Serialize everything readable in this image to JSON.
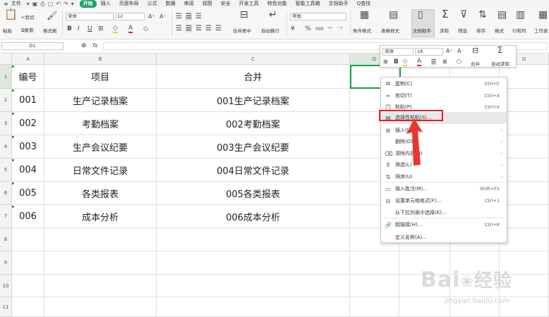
{
  "menubar": {
    "file_label": "文件",
    "items": [
      "开始",
      "插入",
      "页面布局",
      "公式",
      "数据",
      "审阅",
      "视图",
      "安全",
      "开发工具",
      "特色功能",
      "智能工具箱",
      "文档助手"
    ],
    "active_index": 0,
    "search_label": "Q查找"
  },
  "toolbar": {
    "paste": "粘贴",
    "cut": "剪切",
    "copy": "复制",
    "format_painter": "格式刷",
    "font_name": "宋体",
    "font_size": "12",
    "merge_center": "合并居中",
    "wrap_text": "自动换行",
    "number_format": "常规",
    "percent_symbol": "%",
    "thousands": "000",
    "cond_format": "条件格式",
    "table_style": "表格样式",
    "doc_helper": "文档助手",
    "sum": "求和",
    "filter": "筛选",
    "sort": "排序",
    "format": "格式",
    "rows_cols": "行和列",
    "worksheet": "工作表"
  },
  "formula_bar": {
    "name_box": "D1",
    "fx_label": "fx",
    "value": ""
  },
  "grid": {
    "columns": [
      "A",
      "B",
      "C",
      "D",
      "E",
      "F",
      "G"
    ],
    "row_numbers": [
      "1",
      "2",
      "3",
      "4",
      "5",
      "6",
      "7",
      "8",
      "9",
      "10",
      "11"
    ],
    "rows": [
      [
        "编号",
        "项目",
        "合并"
      ],
      [
        "001",
        "生产记录档案",
        "001生产记录档案"
      ],
      [
        "002",
        "考勤档案",
        "002考勤档案"
      ],
      [
        "003",
        "生产会议纪要",
        "003生产会议纪要"
      ],
      [
        "004",
        "日常文件记录",
        "004日常文件记录"
      ],
      [
        "005",
        "各类报表",
        "005各类报表"
      ],
      [
        "006",
        "成本分析",
        "006成本分析"
      ]
    ]
  },
  "mini_toolbar": {
    "font_name": "宋体",
    "font_size": "18",
    "merge": "合并",
    "autosum": "自动求和"
  },
  "context_menu": {
    "items": [
      {
        "label": "复制(C)",
        "shortcut": "Ctrl+C",
        "icon": "copy-icon",
        "glyph": "⧉",
        "arrow": ""
      },
      {
        "label": "剪切(T)",
        "shortcut": "Ctrl+X",
        "icon": "cut-icon",
        "glyph": "✂",
        "arrow": ""
      },
      {
        "label": "粘贴(P)",
        "shortcut": "Ctrl+V",
        "icon": "paste-icon",
        "glyph": "📋",
        "arrow": ""
      },
      {
        "label": "选择性粘贴(S)...",
        "shortcut": "",
        "icon": "paste-special-icon",
        "glyph": "▤",
        "arrow": ""
      },
      {
        "label": "插入(I)",
        "shortcut": "",
        "icon": "insert-icon",
        "glyph": "⊞",
        "arrow": "›"
      },
      {
        "label": "删除(D)",
        "shortcut": "",
        "icon": "",
        "glyph": "",
        "arrow": "›"
      },
      {
        "label": "清除内容(N)",
        "shortcut": "",
        "icon": "clear-icon",
        "glyph": "⌫",
        "arrow": "›"
      },
      {
        "label": "筛选(L)",
        "shortcut": "",
        "icon": "filter-icon",
        "glyph": "⊽",
        "arrow": "›"
      },
      {
        "label": "排序(U)",
        "shortcut": "",
        "icon": "sort-icon",
        "glyph": "⇅",
        "arrow": "›"
      },
      {
        "label": "插入批注(M)...",
        "shortcut": "Shift+F2",
        "icon": "comment-icon",
        "glyph": "▭",
        "arrow": ""
      },
      {
        "label": "设置单元格格式(F)...",
        "shortcut": "Ctrl+1",
        "icon": "format-cells-icon",
        "glyph": "⊟",
        "arrow": ""
      },
      {
        "label": "从下拉列表中选择(K)...",
        "shortcut": "",
        "icon": "",
        "glyph": "",
        "arrow": ""
      },
      {
        "label": "超链接(H)...",
        "shortcut": "Ctrl+K",
        "icon": "link-icon",
        "glyph": "🔗",
        "arrow": ""
      },
      {
        "label": "定义名称(A)...",
        "shortcut": "",
        "icon": "",
        "glyph": "",
        "arrow": ""
      }
    ]
  },
  "watermark": {
    "brand": "Bai",
    "brand2": "经验",
    "url": "jingyan.baidu.com"
  },
  "colors": {
    "accent_green": "#1aa260",
    "highlight_red": "#e02020",
    "selection_green": "#1e9e4a"
  }
}
